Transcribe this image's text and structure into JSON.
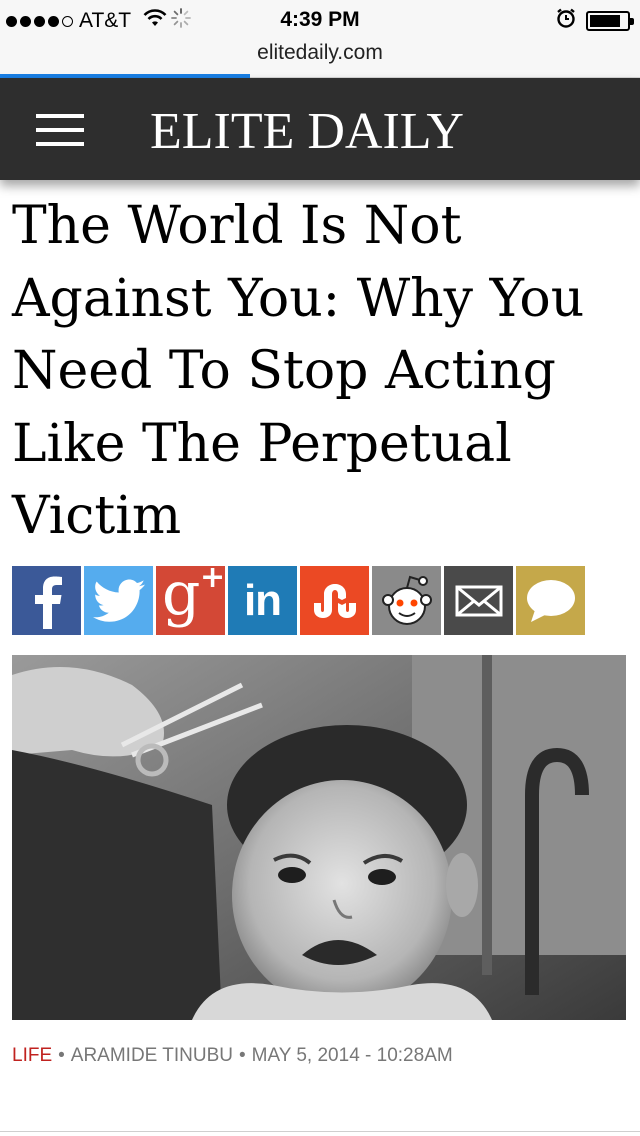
{
  "status_bar": {
    "carrier": "AT&T",
    "time": "4:39 PM",
    "signal_bars_filled": 4,
    "signal_bars_total": 5,
    "battery_level": 0.85,
    "icons": [
      "wifi-icon",
      "activity-spinner-icon",
      "alarm-clock-icon",
      "battery-icon"
    ]
  },
  "browser": {
    "url": "elitedaily.com",
    "load_progress": 0.39,
    "progress_color": "#1a7fe5"
  },
  "header": {
    "logo": "ELITE DAILY",
    "background": "#2e2e2e",
    "menu_icon": "hamburger-menu-icon"
  },
  "article": {
    "headline": "The World Is Not Against You: Why You Need To Stop Acting Like The Perpetual Victim",
    "category": "LIFE",
    "author": "ARAMIDE TINUBU",
    "date": "MAY 5, 2014 - 10:28AM",
    "separator": "•",
    "category_color": "#c0221f",
    "hero_image": "black-and-white photo of a crying toddler getting a haircut"
  },
  "share_buttons": [
    {
      "name": "facebook",
      "icon": "facebook-icon",
      "color": "#3b5998"
    },
    {
      "name": "twitter",
      "icon": "twitter-icon",
      "color": "#55acee"
    },
    {
      "name": "google-plus",
      "icon": "google-plus-icon",
      "color": "#d34836"
    },
    {
      "name": "linkedin",
      "icon": "linkedin-icon",
      "color": "#1f7bb6"
    },
    {
      "name": "stumbleupon",
      "icon": "stumbleupon-icon",
      "color": "#eb4924"
    },
    {
      "name": "reddit",
      "icon": "reddit-icon",
      "color": "#8a8a8a"
    },
    {
      "name": "email",
      "icon": "email-icon",
      "color": "#4a4a4a"
    },
    {
      "name": "comments",
      "icon": "speech-bubble-icon",
      "color": "#c5a84a"
    }
  ]
}
